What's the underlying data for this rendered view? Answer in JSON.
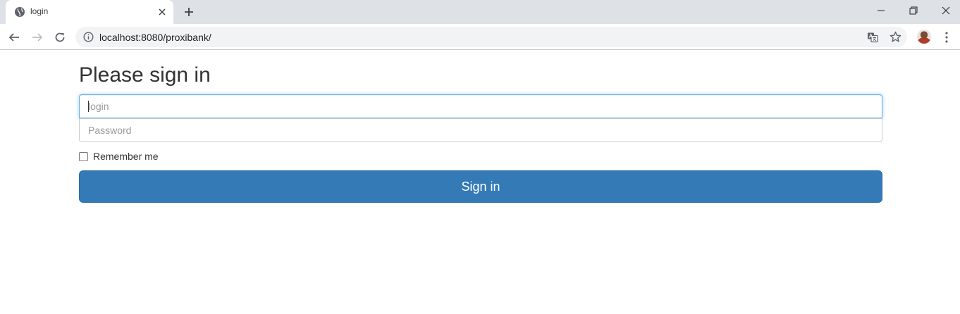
{
  "browser": {
    "tab_title": "login",
    "url": "localhost:8080/proxibank/"
  },
  "icons": {
    "favicon": "globe-icon",
    "tab_close": "close-icon",
    "new_tab": "plus-icon",
    "back": "arrow-left-icon",
    "forward": "arrow-right-icon",
    "reload": "reload-icon",
    "site_info": "info-icon",
    "translate": "translate-icon",
    "bookmark": "star-icon",
    "menu": "more-vertical-icon"
  },
  "page": {
    "heading": "Please sign in",
    "login_placeholder": "login",
    "password_placeholder": "Password",
    "remember_label": "Remember me",
    "submit_label": "Sign in"
  },
  "colors": {
    "primary": "#337ab7",
    "focus": "#66afe9",
    "tabstrip": "#dee1e6"
  }
}
